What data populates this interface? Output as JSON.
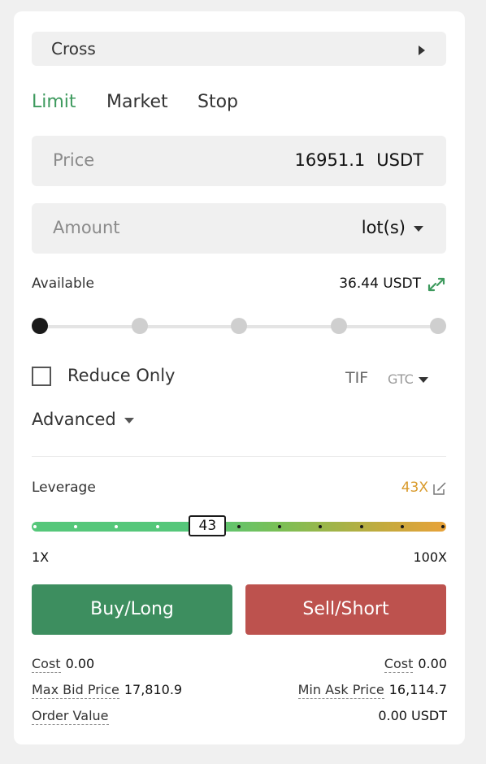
{
  "margin_mode": {
    "label": "Cross"
  },
  "tabs": [
    {
      "label": "Limit",
      "active": true
    },
    {
      "label": "Market",
      "active": false
    },
    {
      "label": "Stop",
      "active": false
    }
  ],
  "price": {
    "placeholder": "Price",
    "value": "16951.1",
    "unit": "USDT"
  },
  "amount": {
    "placeholder": "Amount",
    "unit": "lot(s)"
  },
  "available": {
    "label": "Available",
    "value": "36.44 USDT",
    "icon": "transfer-icon"
  },
  "amount_slider": {
    "steps": 5,
    "selected_index": 0
  },
  "reduce_only": {
    "label": "Reduce Only",
    "checked": false
  },
  "tif": {
    "label": "TIF",
    "value": "GTC"
  },
  "advanced": {
    "label": "Advanced"
  },
  "leverage": {
    "label": "Leverage",
    "value_text": "43X",
    "value": 43,
    "min_label": "1X",
    "max_label": "100X",
    "handle_label": "43"
  },
  "buttons": {
    "buy": "Buy/Long",
    "sell": "Sell/Short"
  },
  "summary": {
    "cost_left": {
      "label": "Cost",
      "value": "0.00"
    },
    "cost_right": {
      "label": "Cost",
      "value": "0.00"
    },
    "max_bid": {
      "label": "Max Bid Price",
      "value": "17,810.9"
    },
    "min_ask": {
      "label": "Min Ask Price",
      "value": "16,114.7"
    },
    "order_value": {
      "label": "Order Value",
      "value": "0.00 USDT"
    }
  },
  "colors": {
    "accent_green": "#3e9a5e",
    "buy": "#3d8e5f",
    "sell": "#bd524e",
    "leverage_orange": "#d99a2b"
  }
}
